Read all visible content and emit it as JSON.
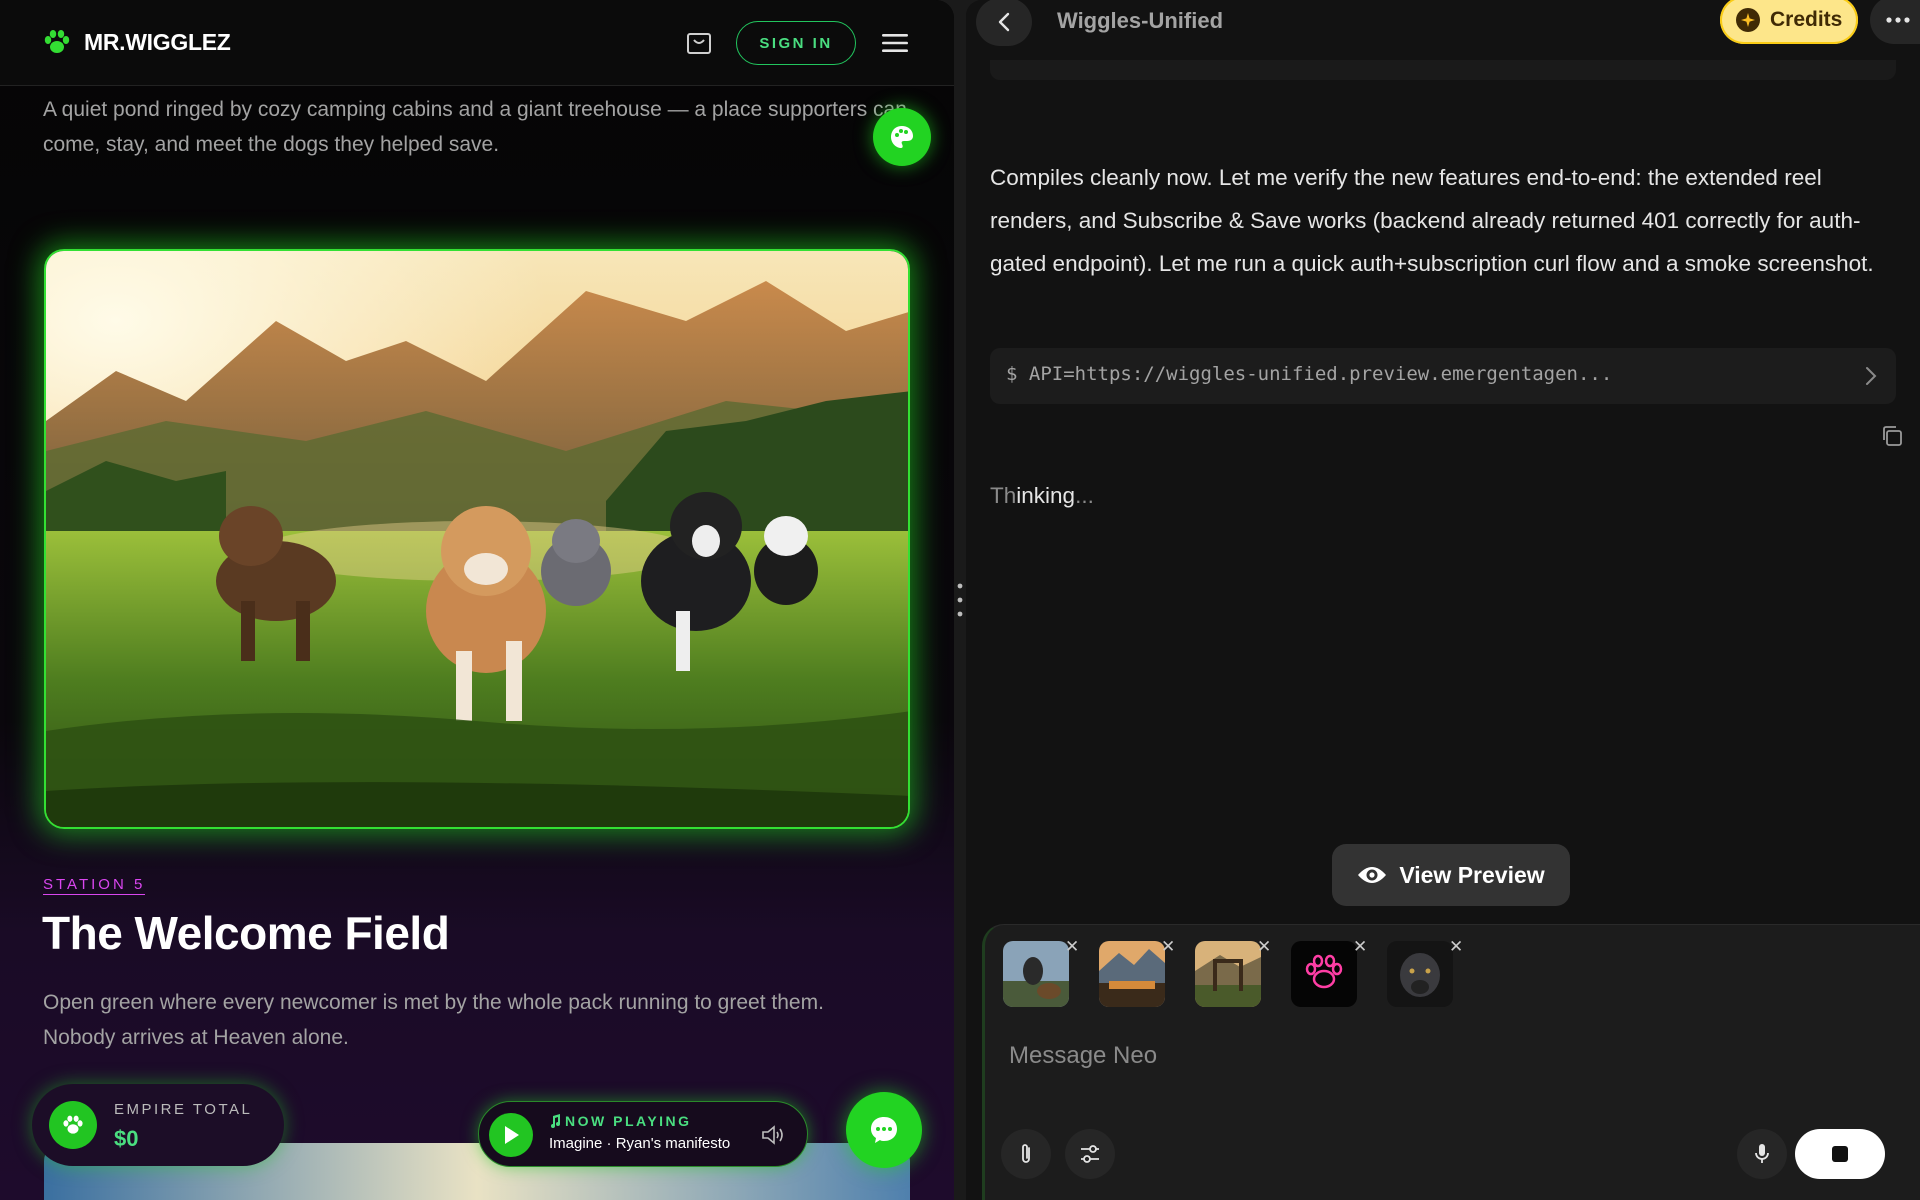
{
  "site": {
    "logo_text": "MR.WIGGLEZ",
    "sign_in": "SIGN IN",
    "intro": "A quiet pond ringed by cozy camping cabins and a giant treehouse — a place supporters can come, stay, and meet the dogs they helped save.",
    "station_label": "STATION 5",
    "station_title": "The Welcome Field",
    "station_desc": "Open green where every newcomer is met by the whole pack running to greet them. Nobody arrives at Heaven alone.",
    "empire_label": "EMPIRE TOTAL",
    "empire_value": "$0",
    "now_playing_label": "NOW PLAYING",
    "now_playing_track": "Imagine · Ryan's manifesto"
  },
  "chat": {
    "title": "Wiggles-Unified",
    "credits_label": "Credits",
    "message": "Compiles cleanly now. Let me verify the new features end-to-end: the extended reel renders, and Subscribe & Save works (backend already returned 401 correctly for auth-gated endpoint). Let me run a quick auth+subscription curl flow and a smoke screenshot.",
    "command": "$ API=https://wiggles-unified.preview.emergentagen...",
    "thinking_bright": "Thinking",
    "thinking_dim": "...",
    "thinking_lead": "Th",
    "view_preview": "View Preview",
    "input_placeholder": "Message Neo"
  },
  "colors": {
    "brand_green": "#22d322",
    "accent_magenta": "#d946ef",
    "credits_yellow": "#fde68a"
  },
  "icons": {
    "logo": "paw-icon",
    "cart": "cart-icon",
    "menu": "hamburger-icon",
    "palette": "palette-icon",
    "play": "play-icon",
    "volume": "volume-icon",
    "chat": "chat-bubble-icon",
    "back": "chevron-left-icon",
    "more": "more-dots-icon",
    "copy": "copy-icon",
    "eye": "eye-icon",
    "attach": "paperclip-icon",
    "settings": "sliders-icon",
    "mic": "microphone-icon",
    "stop": "stop-icon"
  }
}
